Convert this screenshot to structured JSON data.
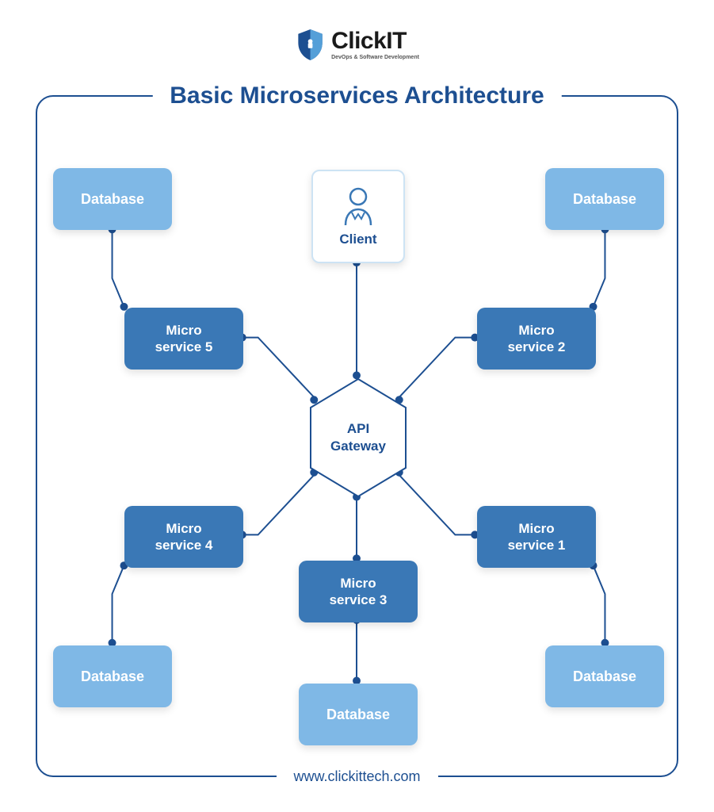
{
  "brand": {
    "name": "ClickIT",
    "tagline": "DevOps & Software Development"
  },
  "diagram": {
    "title": "Basic Microservices Architecture",
    "footer": "www.clickittech.com",
    "client_label": "Client",
    "gateway_label": "API\nGateway",
    "microservices": {
      "ms1": "Micro\nservice 1",
      "ms2": "Micro\nservice 2",
      "ms3": "Micro\nservice 3",
      "ms4": "Micro\nservice 4",
      "ms5": "Micro\nservice 5"
    },
    "database_label": "Database"
  },
  "colors": {
    "brand_blue": "#1d4f91",
    "ms_blue": "#3a78b6",
    "db_blue": "#7fb8e6"
  }
}
